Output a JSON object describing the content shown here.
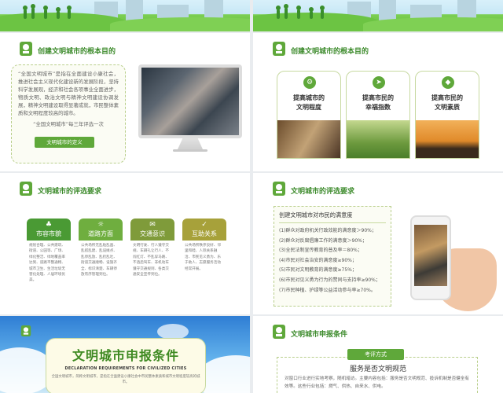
{
  "slide3": {
    "title": "创建文明城市的根本目的",
    "para": "“全国文明城市”是指在全面建设小康社会，推进社会主义现代化建设新的发展阶段，坚持科学发展观，经济和社会各项事业全面进步，物质文明、政治文明与精神文明建设协调发展，精神文明建设取得显著成就，市民整体素质和文明程度较高的城市。",
    "para2": "“全国文明城市”每三年评选一次",
    "button": "文明城市的定义"
  },
  "slide4": {
    "title": "创建文明城市的根本目的",
    "cards": [
      {
        "label1": "提高城市的",
        "label2": "文明程度",
        "icon": "gear-icon"
      },
      {
        "label1": "提高市民的",
        "label2": "幸福指数",
        "icon": "paper-plane-icon"
      },
      {
        "label1": "提高市民的",
        "label2": "文明素质",
        "icon": "tag-icon"
      }
    ]
  },
  "slide5": {
    "title": "文明城市的评选要求",
    "tiles": [
      {
        "label": "市容市貌",
        "body": "规划合理、公共建筑、街道、公园等、广场、绿化整洁、绿地覆盖率达到、道路平整通畅、城市卫生、生活垃圾无害化处理、人居环境优美。",
        "color": "#4a9a34",
        "icon": "leaf-icon"
      },
      {
        "label": "道路方面",
        "body": "公共场所无乱贴乱画、乱搭乱建、乱设摊点、乱停乱放、乱扔乱吐、街道交通顺畅、设施齐全、标识清楚、车辆停放有序管理到位。",
        "color": "#6fae3f",
        "icon": "sun-icon"
      },
      {
        "label": "交通意识",
        "body": "文明行驶、行人遵守交规、车辆礼让行人、不闯红灯、不乱穿马路、不酒后驾车、非机动车遵守交通规则、各类交通安全宣传到位。",
        "color": "#7f9b3a",
        "icon": "chat-icon"
      },
      {
        "label": "互助关系",
        "body": "公共场所秩序良好、邻里和睦、人际关系融洽、市民见义勇为、乐于助人、志愿服务活动经常开展。",
        "color": "#a7a13a",
        "icon": "check-icon"
      }
    ]
  },
  "slide6": {
    "title": "文明城市的评选要求",
    "head": "创建文明城市对市民的满意度",
    "lines": [
      "(1)群众对政府机关行政效能的满意度＞90%；",
      "(2)群众对反腐倡廉工作的满意度＞90%；",
      "(3)全民法制宣传教育的普及率＝80%；",
      "(4)市民对社会治安的满意度≥90%；",
      "(5)市民对文明教育的满意度≥75%；",
      "(6)市民对见义勇为行为的赞同与支持率≥90%；",
      "(7)市民种植、护绿等公益活动参与率≥70%。"
    ]
  },
  "slide7": {
    "title": "文明城市申报条件",
    "en": "DECLARATION REQUIREMENTS FOR CIVILIZED CITIES",
    "body": "全国文明城市，简称文明城市，是指在全面建设小康社会中市民整体素质和城市文明程度较高的城市。"
  },
  "slide8": {
    "title": "文明城市申报条件",
    "tag": "考评方式",
    "sub": "服务是否文明规范",
    "body": "对窗口行业进行实地考察，随机暗访。主要内容包括：服务是否文明规范、投诉机制是否健全有效等。这些行业包括：燃气、供热、自来水、供电。"
  }
}
